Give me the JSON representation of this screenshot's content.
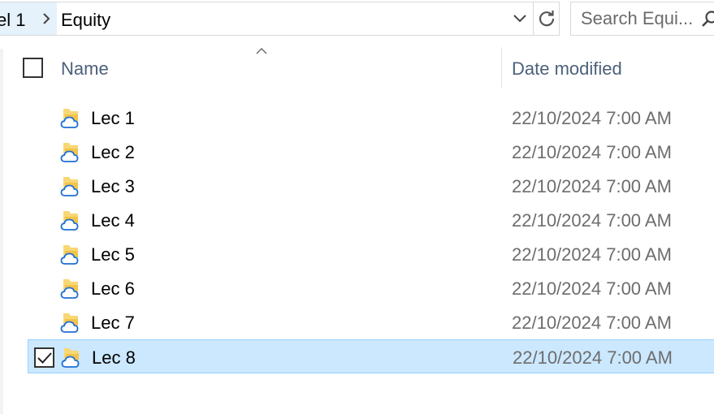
{
  "address_bar": {
    "previous_crumb": "el 1",
    "current_crumb": "Equity"
  },
  "search": {
    "placeholder": "Search Equi..."
  },
  "columns": {
    "name": "Name",
    "date_modified": "Date modified"
  },
  "rows": [
    {
      "name": "Lec 1",
      "date": "22/10/2024 7:00 AM",
      "selected": false
    },
    {
      "name": "Lec 2",
      "date": "22/10/2024 7:00 AM",
      "selected": false
    },
    {
      "name": "Lec 3",
      "date": "22/10/2024 7:00 AM",
      "selected": false
    },
    {
      "name": "Lec 4",
      "date": "22/10/2024 7:00 AM",
      "selected": false
    },
    {
      "name": "Lec 5",
      "date": "22/10/2024 7:00 AM",
      "selected": false
    },
    {
      "name": "Lec 6",
      "date": "22/10/2024 7:00 AM",
      "selected": false
    },
    {
      "name": "Lec 7",
      "date": "22/10/2024 7:00 AM",
      "selected": false
    },
    {
      "name": "Lec 8",
      "date": "22/10/2024 7:00 AM",
      "selected": true
    }
  ],
  "icons": {
    "breadcrumb_separator": "chevron-right-icon",
    "address_dropdown": "chevron-down-icon",
    "refresh": "refresh-icon",
    "search": "search-icon",
    "sort": "sort-up-icon",
    "folder": "folder-cloud-icon",
    "checkmark": "checkmark-icon"
  },
  "colors": {
    "selection_background": "#cce8ff",
    "selection_border": "#99d1ff",
    "breadcrumb_hover": "#e5f1fb",
    "header_text": "#4c607a",
    "cloud_blue": "#1f6fd6",
    "folder_yellow": "#f8d775"
  }
}
